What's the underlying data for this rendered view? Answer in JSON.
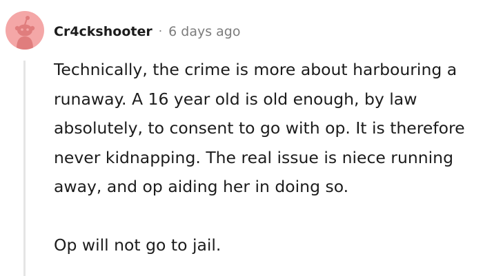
{
  "comment": {
    "author": "Cr4ckshooter",
    "separator": "·",
    "timestamp": "6 days ago",
    "avatar_icon": "reddit-snoo-avatar-icon",
    "paragraphs": [
      "Technically, the crime is more about harbouring a runaway. A 16 year old is old enough, by law absolutely, to consent to go with op. It is therefore never kidnapping. The real issue is niece running away, and op aiding her in doing so.",
      "Op will not go to jail."
    ]
  },
  "colors": {
    "avatar_background": "#f4a7a7",
    "avatar_figure": "#e07d7d",
    "text": "#1c1c1c",
    "meta_text": "#7c7c7c",
    "thread_line": "#e5e5e5"
  }
}
